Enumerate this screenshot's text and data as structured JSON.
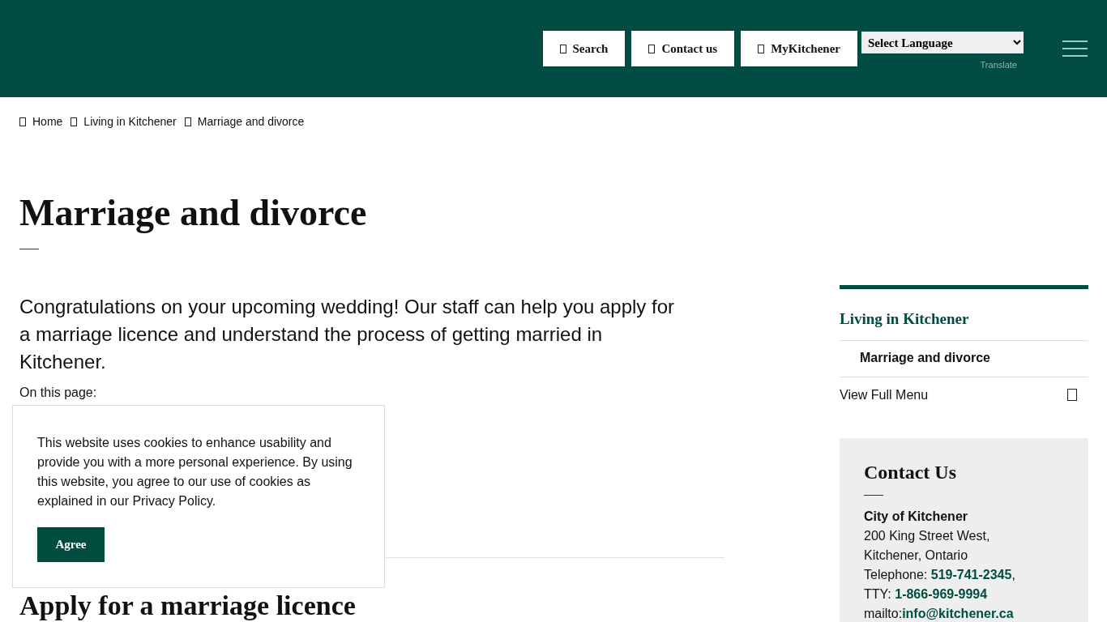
{
  "header": {
    "buttons": [
      {
        "label": "Search"
      },
      {
        "label": "Contact us"
      },
      {
        "label": "MyKitchener"
      }
    ],
    "language_select": {
      "value": "Select Language"
    },
    "translate_label": "Translate"
  },
  "breadcrumbs": [
    {
      "label": "Home"
    },
    {
      "label": "Living in Kitchener"
    },
    {
      "label": "Marriage and divorce"
    }
  ],
  "page_title": "Marriage and divorce",
  "intro": "Congratulations on your upcoming wedding! Our staff can help you apply for a marriage licence and understand the process of getting married in Kitchener.",
  "on_this_page_label": "On this page:",
  "section_heading": "Apply for a marriage licence",
  "sidebar": {
    "section_title": "Living in Kitchener",
    "items": [
      {
        "label": "Marriage and divorce",
        "selected": true
      }
    ],
    "full_menu_label": "View Full Menu",
    "contact": {
      "title": "Contact Us",
      "org": "City of Kitchener",
      "address_1": "200 King Street West,",
      "address_2": "Kitchener, Ontario",
      "phone_label": "Telephone: ",
      "phone": "519-741-2345",
      "phone_suffix": ",",
      "tty_label": "TTY: ",
      "tty": "1-866-969-9994",
      "mail_label": "mailto:",
      "email": "info@kitchener.ca"
    }
  },
  "cookie_banner": {
    "text": "This website uses cookies to enhance usability and provide you with a more personal experience. By using this website, you agree to our use of cookies as explained in our Privacy Policy.",
    "button": "Agree"
  }
}
